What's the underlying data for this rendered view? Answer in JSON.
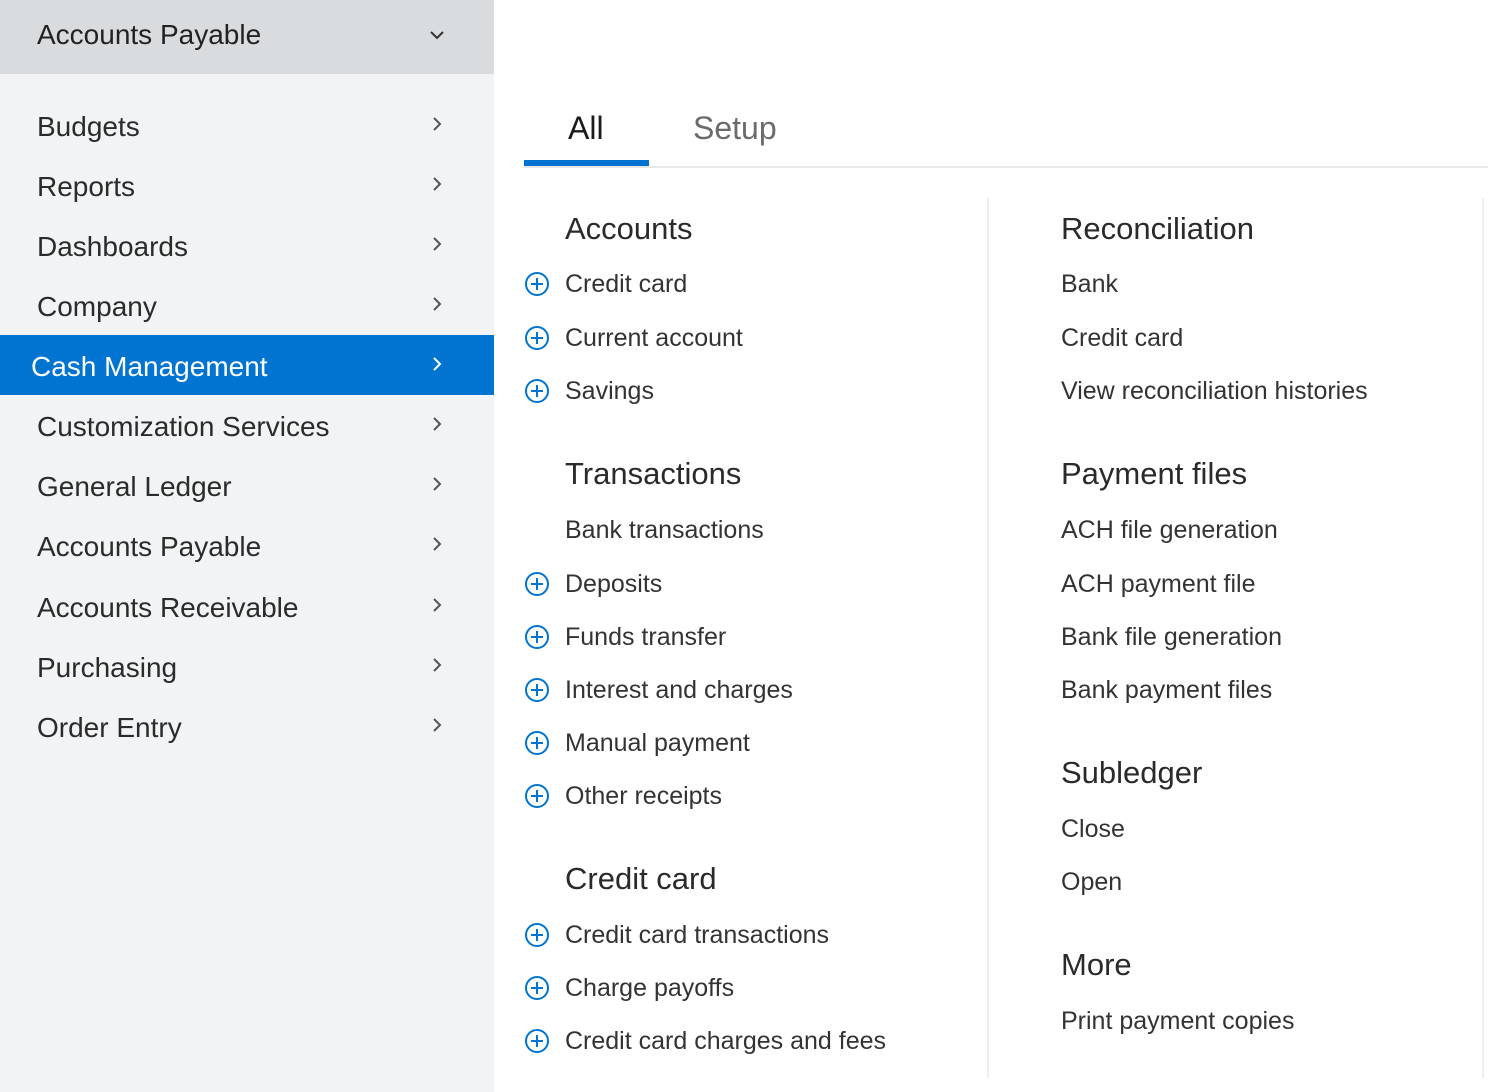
{
  "sidebar": {
    "header_label": "Accounts Payable",
    "items": [
      {
        "label": "Budgets"
      },
      {
        "label": "Reports"
      },
      {
        "label": "Dashboards"
      },
      {
        "label": "Company"
      },
      {
        "label": "Cash Management"
      },
      {
        "label": "Customization Services"
      },
      {
        "label": "General Ledger"
      },
      {
        "label": "Accounts Payable"
      },
      {
        "label": "Accounts Receivable"
      },
      {
        "label": "Purchasing"
      },
      {
        "label": "Order Entry"
      }
    ],
    "active_item": "Cash Management"
  },
  "tabs": [
    {
      "label": "All"
    },
    {
      "label": "Setup"
    }
  ],
  "active_tab": "All",
  "left_column": {
    "accounts": {
      "title": "Accounts",
      "items": [
        {
          "label": "Credit card"
        },
        {
          "label": "Current account"
        },
        {
          "label": "Savings"
        }
      ]
    },
    "transactions": {
      "title": "Transactions",
      "items": [
        {
          "label": "Bank transactions"
        },
        {
          "label": "Deposits"
        },
        {
          "label": "Funds transfer"
        },
        {
          "label": "Interest and charges"
        },
        {
          "label": "Manual payment"
        },
        {
          "label": "Other receipts"
        }
      ]
    },
    "credit_card": {
      "title": "Credit card",
      "items": [
        {
          "label": "Credit card transactions"
        },
        {
          "label": "Charge payoffs"
        },
        {
          "label": "Credit card charges and fees"
        }
      ]
    }
  },
  "right_column": {
    "reconciliation": {
      "title": "Reconciliation",
      "items": [
        {
          "label": "Bank"
        },
        {
          "label": "Credit card"
        },
        {
          "label": "View reconciliation histories"
        }
      ]
    },
    "payment_files": {
      "title": "Payment files",
      "items": [
        {
          "label": "ACH file generation"
        },
        {
          "label": "ACH payment file"
        },
        {
          "label": "Bank file generation"
        },
        {
          "label": "Bank payment files"
        }
      ]
    },
    "subledger": {
      "title": "Subledger",
      "items": [
        {
          "label": "Close"
        },
        {
          "label": "Open"
        }
      ]
    },
    "more": {
      "title": "More",
      "items": [
        {
          "label": "Print payment copies"
        }
      ]
    }
  },
  "colors": {
    "accent": "#0074d0",
    "sidebar_bg": "#f1f3f4",
    "sidebar_header_bg": "#d9dcdf"
  }
}
